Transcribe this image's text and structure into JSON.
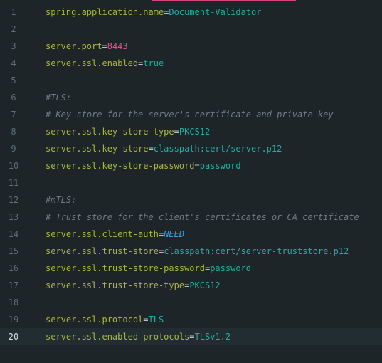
{
  "editor": {
    "lines": [
      {
        "number": "1",
        "key": "spring.application.name",
        "sep": "=",
        "value": "Document-Validator",
        "vtype": "val"
      },
      {
        "number": "2"
      },
      {
        "number": "3",
        "key": "server.port",
        "sep": "=",
        "value": "8443",
        "vtype": "num"
      },
      {
        "number": "4",
        "key": "server.ssl.enabled",
        "sep": "=",
        "value": "true",
        "vtype": "val"
      },
      {
        "number": "5"
      },
      {
        "number": "6",
        "comment": "#TLS:"
      },
      {
        "number": "7",
        "comment": "# Key store for the server's certificate and private key"
      },
      {
        "number": "8",
        "key": "server.ssl.key-store-type",
        "sep": "=",
        "value": "PKCS12",
        "vtype": "val"
      },
      {
        "number": "9",
        "key": "server.ssl.key-store",
        "sep": "=",
        "value": "classpath:cert/server.p12",
        "vtype": "val"
      },
      {
        "number": "10",
        "key": "server.ssl.key-store-password",
        "sep": "=",
        "value": "password",
        "vtype": "val"
      },
      {
        "number": "11"
      },
      {
        "number": "12",
        "comment": "#mTLS:"
      },
      {
        "number": "13",
        "comment": "# Trust store for the client's certificates or CA certificate"
      },
      {
        "number": "14",
        "key": "server.ssl.client-auth",
        "sep": "=",
        "value": "NEED",
        "vtype": "const"
      },
      {
        "number": "15",
        "key": "server.ssl.trust-store",
        "sep": "=",
        "value": "classpath:cert/server-truststore.p12",
        "vtype": "val"
      },
      {
        "number": "16",
        "key": "server.ssl.trust-store-password",
        "sep": "=",
        "value": "password",
        "vtype": "val"
      },
      {
        "number": "17",
        "key": "server.ssl.trust-store-type",
        "sep": "=",
        "value": "PKCS12",
        "vtype": "val"
      },
      {
        "number": "18"
      },
      {
        "number": "19",
        "key": "server.ssl.protocol",
        "sep": "=",
        "value": "TLS",
        "vtype": "val"
      },
      {
        "number": "20",
        "key": "server.ssl.enabled-protocols",
        "sep": "=",
        "value": "TLSv1.2",
        "vtype": "val",
        "current": true
      }
    ]
  }
}
